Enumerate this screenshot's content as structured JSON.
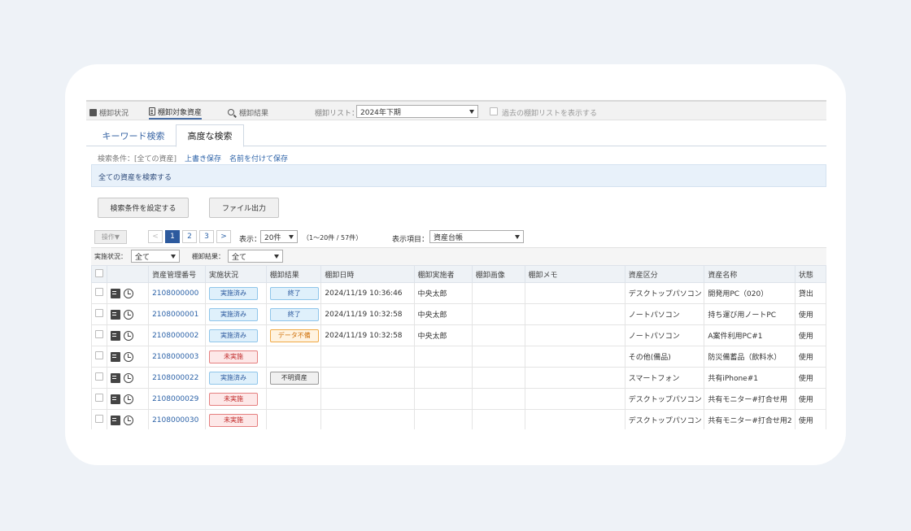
{
  "nav": {
    "items": [
      "棚卸状況",
      "棚卸対象資産",
      "棚卸結果"
    ],
    "list_label": "棚卸リスト：",
    "list_value": "2024年下期",
    "past_label": "過去の棚卸リストを表示する"
  },
  "tabs": {
    "keyword": "キーワード検索",
    "advanced": "高度な検索"
  },
  "condition": {
    "label": "検索条件：[全ての資産]",
    "overwrite": "上書き保存",
    "save_as": "名前を付けて保存"
  },
  "banner": "全ての資産を検索する",
  "buttons": {
    "set_condition": "検索条件を設定する",
    "export": "ファイル出力",
    "operation": "操作▼"
  },
  "pager": {
    "prev": "<",
    "pages": [
      "1",
      "2",
      "3"
    ],
    "next": ">",
    "display_label": "表示：",
    "per_page": "20件",
    "range": "（1～20件 / 57件）",
    "items_label": "表示項目：",
    "items_value": "資産台帳"
  },
  "filters": {
    "status_label": "実施状況：",
    "status_value": "全て",
    "result_label": "棚卸結果：",
    "result_value": "全て"
  },
  "table": {
    "headers": [
      "",
      "",
      "資産管理番号",
      "実施状況",
      "棚卸結果",
      "棚卸日時",
      "棚卸実施者",
      "棚卸画像",
      "棚卸メモ",
      "資産区分",
      "資産名称",
      "状態"
    ],
    "rows": [
      {
        "id": "2108000000",
        "status": "実施済み",
        "status_type": "done",
        "result": "終了",
        "result_type": "end",
        "date": "2024/11/19 10:36:46",
        "by": "中央太郎",
        "category": "デスクトップパソコン",
        "name": "開発用PC（020）",
        "state": "貸出"
      },
      {
        "id": "2108000001",
        "status": "実施済み",
        "status_type": "done",
        "result": "終了",
        "result_type": "end",
        "date": "2024/11/19 10:32:58",
        "by": "中央太郎",
        "category": "ノートパソコン",
        "name": "持ち運び用ノートPC",
        "state": "使用"
      },
      {
        "id": "2108000002",
        "status": "実施済み",
        "status_type": "done",
        "result": "データ不備",
        "result_type": "miss",
        "date": "2024/11/19 10:32:58",
        "by": "中央太郎",
        "category": "ノートパソコン",
        "name": "A案件利用PC#1",
        "state": "使用"
      },
      {
        "id": "2108000003",
        "status": "未実施",
        "status_type": "not",
        "result": "",
        "result_type": "",
        "date": "",
        "by": "",
        "category": "その他(備品)",
        "name": "防災備蓄品（飲料水）",
        "state": "使用"
      },
      {
        "id": "2108000022",
        "status": "実施済み",
        "status_type": "done",
        "result": "不明資産",
        "result_type": "unk",
        "date": "",
        "by": "",
        "category": "スマートフォン",
        "name": "共有iPhone#1",
        "state": "使用"
      },
      {
        "id": "2108000029",
        "status": "未実施",
        "status_type": "not",
        "result": "",
        "result_type": "",
        "date": "",
        "by": "",
        "category": "デスクトップパソコン",
        "name": "共有モニター#打合せ用",
        "state": "使用"
      },
      {
        "id": "2108000030",
        "status": "未実施",
        "status_type": "not",
        "result": "",
        "result_type": "",
        "date": "",
        "by": "",
        "category": "デスクトップパソコン",
        "name": "共有モニター#打合せ用2",
        "state": "使用"
      }
    ]
  }
}
